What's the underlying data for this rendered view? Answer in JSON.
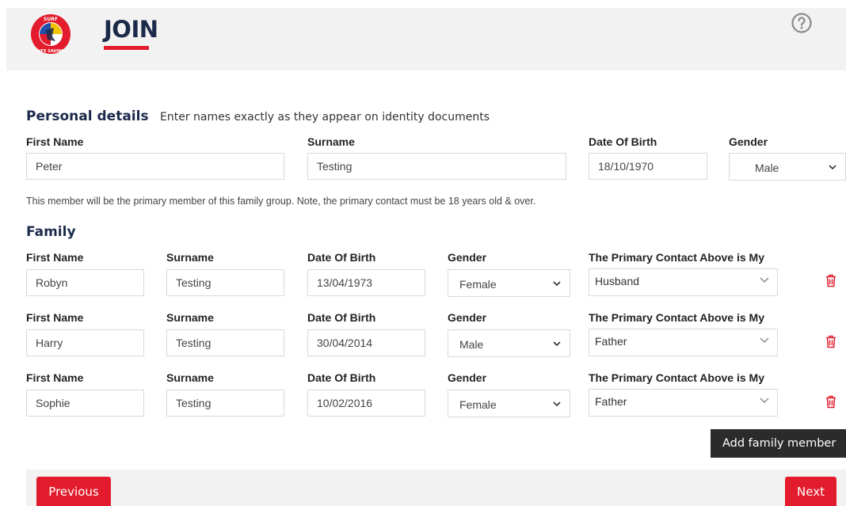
{
  "header": {
    "logo_text": "SURF LIFE SAVING",
    "title": "JOIN"
  },
  "personal": {
    "title": "Personal details",
    "subtitle": "Enter names exactly as they appear on identity documents",
    "labels": {
      "first_name": "First Name",
      "surname": "Surname",
      "dob": "Date Of Birth",
      "gender": "Gender"
    },
    "first_name": "Peter",
    "surname": "Testing",
    "dob": "18/10/1970",
    "gender": "Male",
    "note": "This member will be the primary member of this family group. Note, the primary contact must be 18 years old & over."
  },
  "family": {
    "title": "Family",
    "labels": {
      "first_name": "First Name",
      "surname": "Surname",
      "dob": "Date Of Birth",
      "gender": "Gender",
      "relationship": "The Primary Contact Above is My"
    },
    "members": [
      {
        "first_name": "Robyn",
        "surname": "Testing",
        "dob": "13/04/1973",
        "gender": "Female",
        "relationship": "Husband"
      },
      {
        "first_name": "Harry",
        "surname": "Testing",
        "dob": "30/04/2014",
        "gender": "Male",
        "relationship": "Father"
      },
      {
        "first_name": "Sophie",
        "surname": "Testing",
        "dob": "10/02/2016",
        "gender": "Female",
        "relationship": "Father"
      }
    ],
    "add_button": "Add family member"
  },
  "footer": {
    "previous": "Previous",
    "next": "Next"
  },
  "colors": {
    "brand_red": "#e31c2d",
    "navy": "#1c2a4a",
    "panel_grey": "#f2f2f2",
    "dark_button": "#2b2b2b"
  },
  "icons": [
    "surf-life-saving-logo",
    "help-icon",
    "chevron-down-icon",
    "trash-icon"
  ]
}
